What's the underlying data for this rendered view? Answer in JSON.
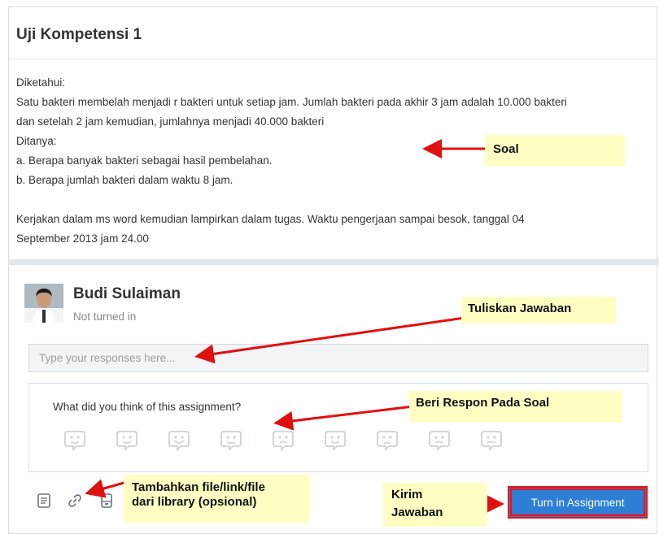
{
  "assignment": {
    "title": "Uji Kompetensi 1",
    "lines": [
      "Diketahui:",
      "Satu bakteri membelah menjadi r bakteri untuk setiap jam. Jumlah bakteri pada akhir 3 jam adalah 10.000 bakteri",
      "dan setelah 2 jam kemudian, jumlahnya menjadi 40.000 bakteri",
      "Ditanya:",
      "a. Berapa banyak bakteri sebagai hasil pembelahan.",
      "b. Berapa jumlah bakteri dalam waktu 8 jam."
    ],
    "instruction_lines": [
      "Kerjakan dalam ms word kemudian lampirkan dalam tugas. Waktu pengerjaan sampai besok, tanggal 04",
      "September 2013 jam 24.00"
    ]
  },
  "submission": {
    "student_name": "Budi Sulaiman",
    "status": "Not turned in",
    "response_placeholder": "Type your responses here...",
    "feedback_question": "What did you think of this assignment?",
    "feedback_icons": [
      "emoji-face-1",
      "emoji-face-2",
      "emoji-face-3",
      "emoji-face-4",
      "emoji-face-5",
      "emoji-face-6",
      "emoji-face-7",
      "emoji-face-8",
      "emoji-face-9"
    ],
    "tools": [
      "note-icon",
      "link-icon",
      "library-icon"
    ],
    "turn_in_label": "Turn in Assignment"
  },
  "annotations": {
    "soal": "Soal",
    "tulis": "Tuliskan Jawaban",
    "respon": "Beri Respon Pada Soal",
    "tambah_1": "Tambahkan file/link/file",
    "tambah_2": "dari library (opsional)",
    "kirim_1": "Kirim",
    "kirim_2": "Jawaban"
  },
  "colors": {
    "accent": "#2d7fd6",
    "callout": "#ffffc4",
    "arrow": "#e01010",
    "emoji": "#d0d6dc"
  }
}
